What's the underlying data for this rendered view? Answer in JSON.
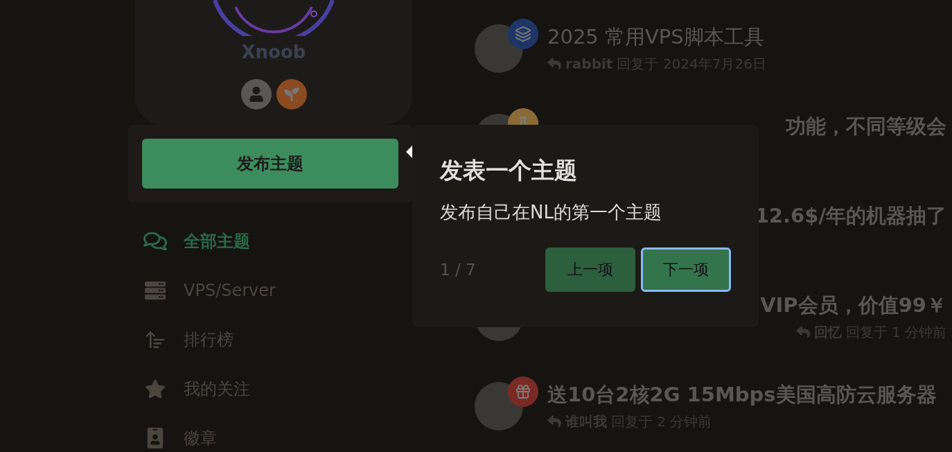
{
  "profile": {
    "name": "Xnoob",
    "badges": [
      {
        "kind": "user",
        "color": "#5a5855"
      },
      {
        "kind": "sprout",
        "color": "#8a4a22"
      }
    ]
  },
  "publish_button": "发布主题",
  "nav": [
    {
      "kind": "chat",
      "label": "全部主题",
      "selected": true
    },
    {
      "kind": "server",
      "label": "VPS/Server",
      "selected": false
    },
    {
      "kind": "rank",
      "label": "排行榜",
      "selected": false
    },
    {
      "kind": "star",
      "label": "我的关注",
      "selected": false
    },
    {
      "kind": "badge",
      "label": "徽章",
      "selected": false
    }
  ],
  "topics": [
    {
      "kind": "full",
      "badge": {
        "kind": "layers",
        "color": "#1f3566"
      },
      "title": "2025 常用VPS脚本工具",
      "read": true,
      "author": "rabbit",
      "reply_text": "回复于 2024年7月26日"
    },
    {
      "kind": "covered",
      "badge": {
        "kind": "flask",
        "color": "#8a6a35"
      },
      "title": "功能，不同等级会",
      "read": false
    },
    {
      "kind": "buried",
      "title": "12.6$/年的机器抽了",
      "read": false
    },
    {
      "kind": "covered",
      "title": "VIP会员，价值99￥",
      "read": false,
      "author": "回忆",
      "reply_text": "回复于 1 分钟前"
    },
    {
      "kind": "full",
      "badge": {
        "kind": "gift",
        "color": "#7a2a25"
      },
      "title": "送10台2核2G 15Mbps美国高防云服务器",
      "read": false,
      "author": "谁叫我",
      "reply_text": "回复于 2 分钟前"
    }
  ],
  "tour": {
    "title": "发表一个主题",
    "description": "发布自己在NL的第一个主题",
    "step": "1 / 7",
    "buttons": [
      {
        "label": "上一项",
        "focused": false
      },
      {
        "label": "下一项",
        "focused": true
      }
    ]
  }
}
